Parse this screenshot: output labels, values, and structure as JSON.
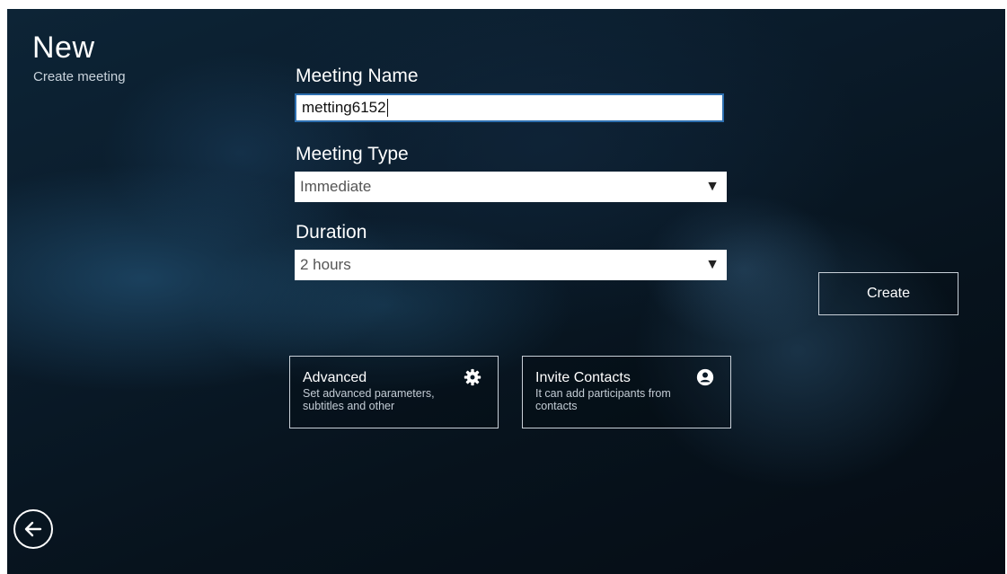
{
  "header": {
    "title": "New",
    "subtitle": "Create meeting"
  },
  "form": {
    "meeting_name": {
      "label": "Meeting Name",
      "value": "metting6152"
    },
    "meeting_type": {
      "label": "Meeting Type",
      "selected": "Immediate"
    },
    "duration": {
      "label": "Duration",
      "selected": "2 hours"
    }
  },
  "actions": {
    "create_label": "Create"
  },
  "cards": {
    "advanced": {
      "title": "Advanced",
      "description": "Set advanced parameters, subtitles and other",
      "icon": "gear-icon"
    },
    "invite": {
      "title": "Invite Contacts",
      "description": "It can add participants from contacts",
      "icon": "user-circle-icon"
    }
  },
  "navigation": {
    "back_icon": "arrow-left-circle-icon"
  },
  "colors": {
    "input_focus_border": "#2d6fb0",
    "background": "#0a1b2a"
  }
}
